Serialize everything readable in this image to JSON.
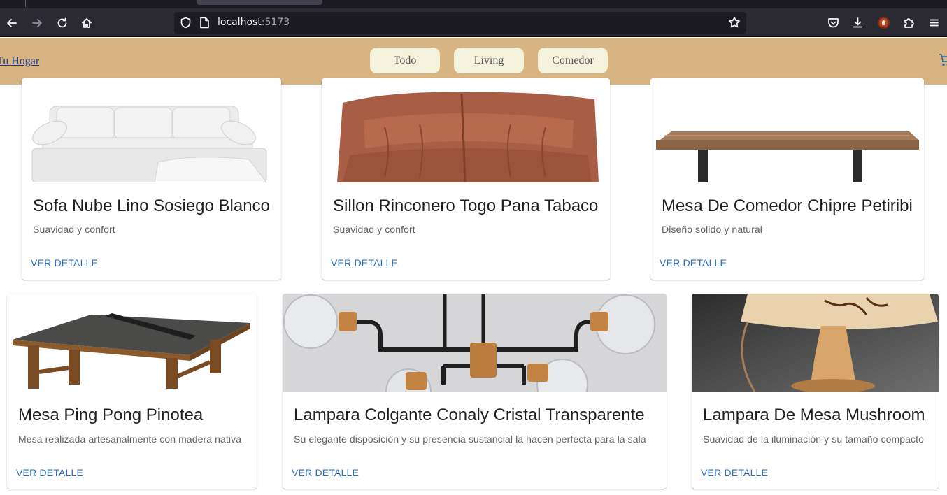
{
  "browser": {
    "url_host": "localhost",
    "url_port": ":5173",
    "icons": [
      "back-icon",
      "forward-icon",
      "reload-icon",
      "home-icon",
      "shield-icon",
      "page-icon",
      "bookmark-star-icon",
      "pocket-icon",
      "download-icon",
      "extension-icon",
      "puzzle-icon",
      "menu-icon"
    ]
  },
  "header": {
    "brand": "Tu Hogar",
    "filters": [
      "Todo",
      "Living",
      "Comedor"
    ],
    "cart_icon": "cart-icon"
  },
  "products": [
    {
      "title": "Sofa Nube Lino Sosiego Blanco",
      "description": "Suavidad y confort",
      "cta": "VER DETALLE"
    },
    {
      "title": "Sillon Rinconero Togo Pana Tabaco",
      "description": "Suavidad y confort",
      "cta": "VER DETALLE"
    },
    {
      "title": "Mesa De Comedor Chipre Petiribi",
      "description": "Diseño solido y natural",
      "cta": "VER DETALLE"
    },
    {
      "title": "Mesa Ping Pong Pinotea",
      "description": "Mesa realizada artesanalmente con madera nativa",
      "cta": "VER DETALLE"
    },
    {
      "title": "Lampara Colgante Conaly Cristal Transparente",
      "description": "Su elegante disposición y su presencia sustancial la hacen perfecta para la sala",
      "cta": "VER DETALLE"
    },
    {
      "title": "Lampara De Mesa Mushroom",
      "description": "Suavidad de la iluminación y su tamaño compacto",
      "cta": "VER DETALLE"
    }
  ],
  "colors": {
    "header_bg": "#d9b483",
    "filter_bg": "#f5f2dc",
    "link": "#2a6fbf",
    "chrome_bg": "#2b2a33"
  }
}
